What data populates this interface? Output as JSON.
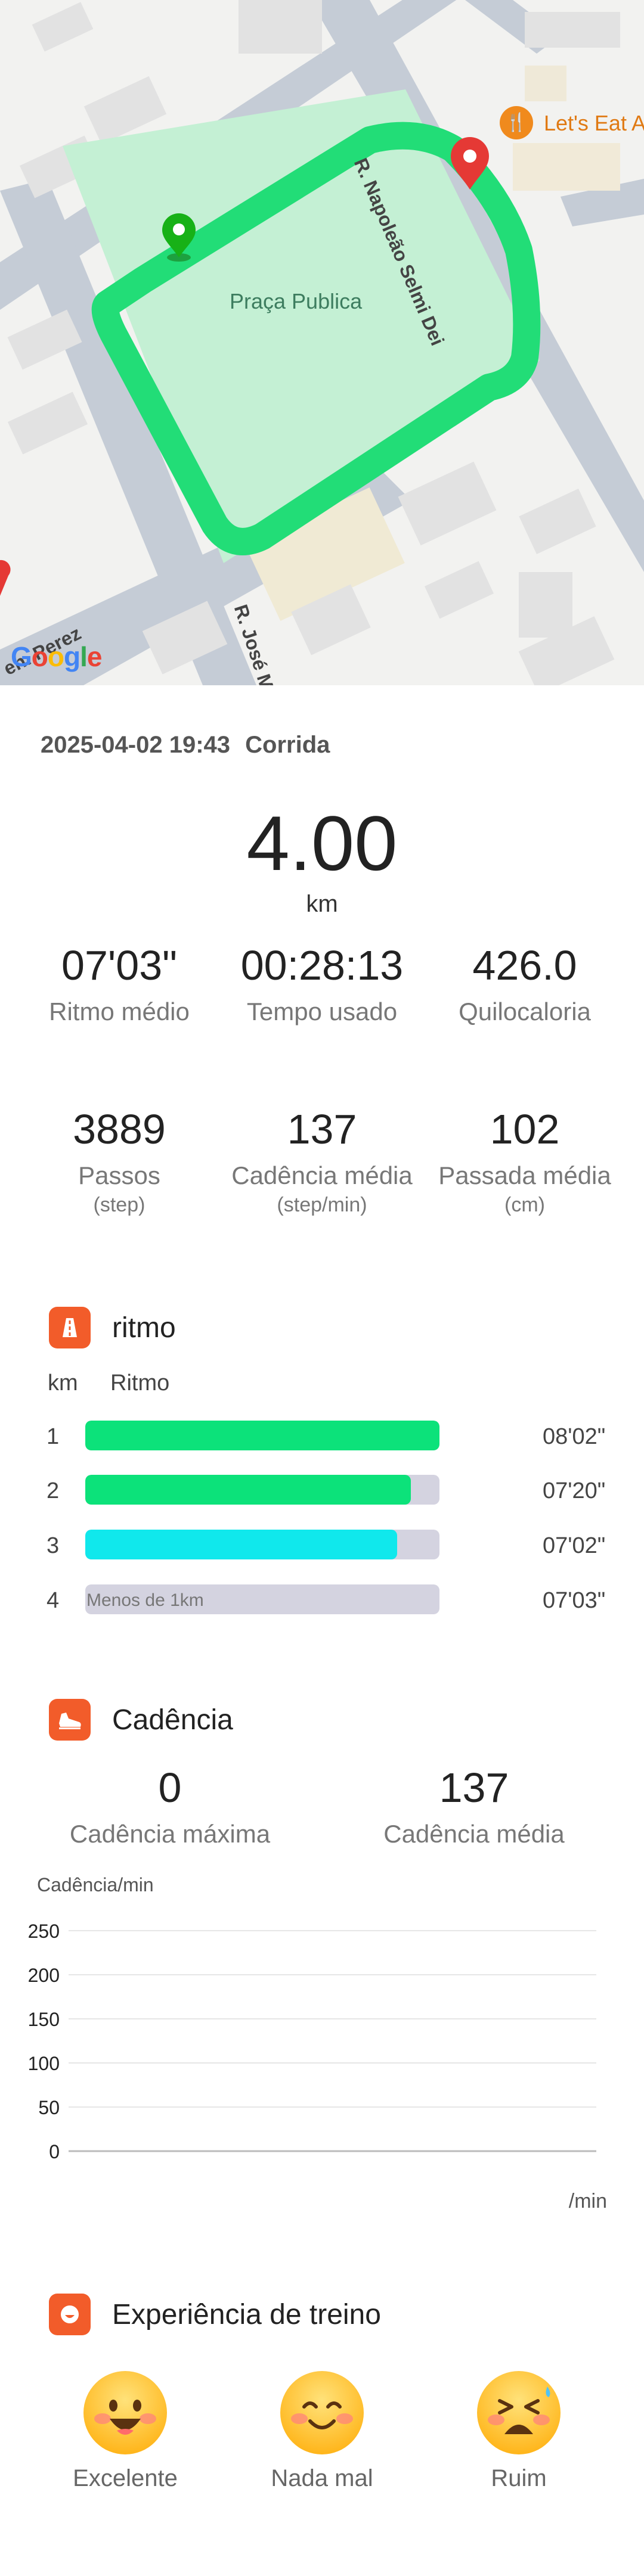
{
  "map": {
    "park_label": "Praça Publica",
    "streets": [
      "R. Napoleão Selmi Dei",
      "R. José M",
      "en. Perez"
    ],
    "poi_label": "Let's Eat A",
    "poi_icon": "restaurant-icon",
    "logo": [
      "G",
      "o",
      "o",
      "g",
      "l",
      "e"
    ],
    "route_color": "#22dd77",
    "park_color": "#c4f0d4",
    "start_marker_color": "#17b117",
    "end_marker_color": "#e53935"
  },
  "workout": {
    "datetime": "2025-04-02 19:43",
    "type": "Corrida"
  },
  "distance": {
    "value": "4.00",
    "unit": "km"
  },
  "stats": [
    {
      "value": "07'03\"",
      "label": "Ritmo médio",
      "sub": ""
    },
    {
      "value": "00:28:13",
      "label": "Tempo usado",
      "sub": ""
    },
    {
      "value": "426.0",
      "label": "Quilocaloria",
      "sub": ""
    },
    {
      "value": "3889",
      "label": "Passos",
      "sub": "(step)"
    },
    {
      "value": "137",
      "label": "Cadência média",
      "sub": "(step/min)"
    },
    {
      "value": "102",
      "label": "Passada média",
      "sub": "(cm)"
    }
  ],
  "pace": {
    "title": "ritmo",
    "icon": "road-icon",
    "header_km": "km",
    "header_pace": "Ritmo",
    "rows": [
      {
        "km": "1",
        "time": "08'02\"",
        "fill": 1.0,
        "color": "#0ce27a",
        "note": ""
      },
      {
        "km": "2",
        "time": "07'20\"",
        "fill": 0.92,
        "color": "#0ce27a",
        "note": ""
      },
      {
        "km": "3",
        "time": "07'02\"",
        "fill": 0.88,
        "color": "#10e8ec",
        "note": ""
      },
      {
        "km": "4",
        "time": "07'03\"",
        "fill": 0.0,
        "color": "#0ce27a",
        "note": "Menos de 1km"
      }
    ]
  },
  "cadence": {
    "title": "Cadência",
    "icon": "shoe-icon",
    "max_value": "0",
    "max_label": "Cadência máxima",
    "avg_value": "137",
    "avg_label": "Cadência média"
  },
  "chart_data": {
    "type": "line",
    "title": "",
    "ylabel": "Cadência/min",
    "xlabel": "/min",
    "ylim": [
      0,
      250
    ],
    "yticks": [
      "250",
      "200",
      "150",
      "100",
      "50",
      "0"
    ],
    "grid": true,
    "series": []
  },
  "experience": {
    "title": "Experiência de treino",
    "icon": "smiley-icon",
    "options": [
      {
        "label": "Excelente",
        "face": "excellent-face-icon"
      },
      {
        "label": "Nada mal",
        "face": "not-bad-face-icon"
      },
      {
        "label": "Ruim",
        "face": "bad-face-icon"
      }
    ]
  }
}
